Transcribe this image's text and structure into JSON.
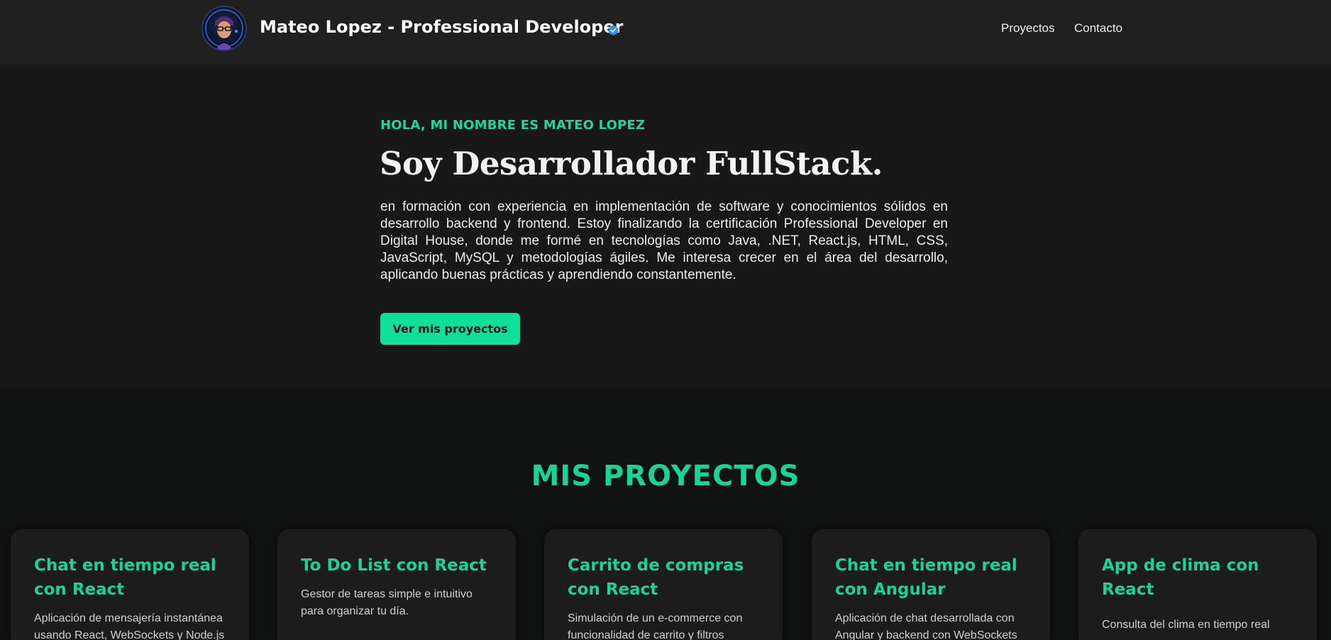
{
  "header": {
    "brand": "Mateo Lopez - Professional Developer",
    "nav": [
      "Proyectos",
      "Contacto"
    ]
  },
  "hero": {
    "eyebrow": "HOLA, MI NOMBRE ES MATEO LOPEZ",
    "title": "Soy Desarrollador FullStack.",
    "text": "en formación con experiencia en implementación de software y conocimientos sólidos en desarrollo backend y frontend. Estoy finalizando la certificación Professional Developer en Digital House, donde me formé en tecnologías como Java, .NET, React.js, HTML, CSS, JavaScript, MySQL y metodologías ágiles. Me interesa crecer en el área del desarrollo, aplicando buenas prácticas y aprendiendo constantemente.",
    "cta": "Ver mis proyectos"
  },
  "projects": {
    "title": "MIS PROYECTOS",
    "cards": [
      {
        "title": "Chat en tiempo real con React",
        "desc": "Aplicación de mensajería instantánea usando React, WebSockets y Node.js"
      },
      {
        "title": "To Do List con React",
        "desc": "Gestor de tareas simple e intuitivo para organizar tu día."
      },
      {
        "title": "Carrito de compras con React",
        "desc": "Simulación de un e-commerce con funcionalidad de carrito y filtros"
      },
      {
        "title": "Chat en tiempo real con Angular",
        "desc": "Aplicación de chat desarrollada con Angular y backend con WebSockets"
      },
      {
        "title": "App de clima con React",
        "desc": "Consulta del clima en tiempo real"
      }
    ]
  },
  "colors": {
    "accent": "#0de09b",
    "header_bg": "#202020",
    "hero_bg": "#181818",
    "page_bg": "#111212",
    "card_bg": "#1c1c1c",
    "verified": "#3b8fe8"
  }
}
